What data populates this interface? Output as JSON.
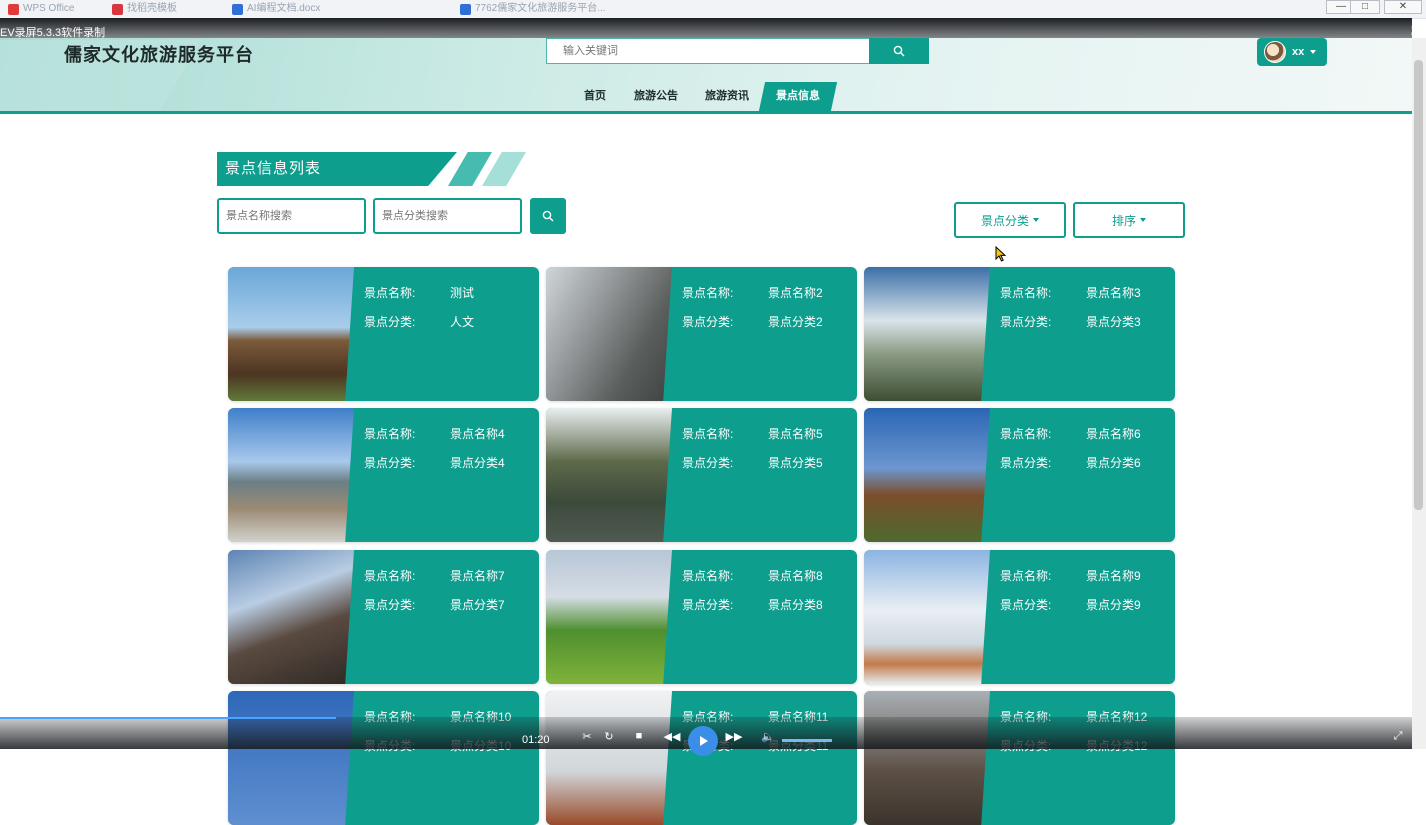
{
  "os_strip": {
    "tabs": [
      {
        "label": "WPS Office",
        "color": "#e03a3a"
      },
      {
        "label": "找稻壳模板",
        "color": "#d9363e"
      },
      {
        "label": "AI编程文档.docx",
        "color": "#2f6fd6"
      },
      {
        "label": "7762儒家文化旅游服务平台...",
        "color": "#2f6fd6"
      }
    ]
  },
  "recorder": {
    "label": "EV录屏5.3.3软件录制"
  },
  "header": {
    "site_title": "儒家文化旅游服务平台",
    "search_placeholder": "输入关键词",
    "user_name": "xx"
  },
  "nav": {
    "items": [
      "首页",
      "旅游公告",
      "旅游资讯",
      "景点信息"
    ],
    "active": "景点信息"
  },
  "section": {
    "title": "景点信息列表",
    "name_placeholder": "景点名称搜索",
    "category_placeholder": "景点分类搜索",
    "category_dropdown": "景点分类",
    "sort_dropdown": "排序"
  },
  "card_labels": {
    "name": "景点名称:",
    "category": "景点分类:"
  },
  "cards": [
    {
      "name": "测试",
      "category": "人文",
      "image": "stave-church"
    },
    {
      "name": "景点名称2",
      "category": "景点分类2",
      "image": "mountain-rocks"
    },
    {
      "name": "景点名称3",
      "category": "景点分类3",
      "image": "misty-peaks"
    },
    {
      "name": "景点名称4",
      "category": "景点分类4",
      "image": "lake-pier"
    },
    {
      "name": "景点名称5",
      "category": "景点分类5",
      "image": "water-town"
    },
    {
      "name": "景点名称6",
      "category": "景点分类6",
      "image": "wooden-church"
    },
    {
      "name": "景点名称7",
      "category": "景点分类7",
      "image": "chinese-gate"
    },
    {
      "name": "景点名称8",
      "category": "景点分类8",
      "image": "green-hill"
    },
    {
      "name": "景点名称9",
      "category": "景点分类9",
      "image": "snow-rime"
    },
    {
      "name": "景点名称10",
      "category": "景点分类10",
      "image": "blue-sky"
    },
    {
      "name": "景点名称11",
      "category": "景点分类11",
      "image": "pagoda"
    },
    {
      "name": "景点名称12",
      "category": "景点分类12",
      "image": "old-building"
    }
  ],
  "player": {
    "time": "01:20",
    "volume": "0.23"
  },
  "colors": {
    "primary": "#0e9e8e",
    "header_bg": "#cbeae5"
  }
}
